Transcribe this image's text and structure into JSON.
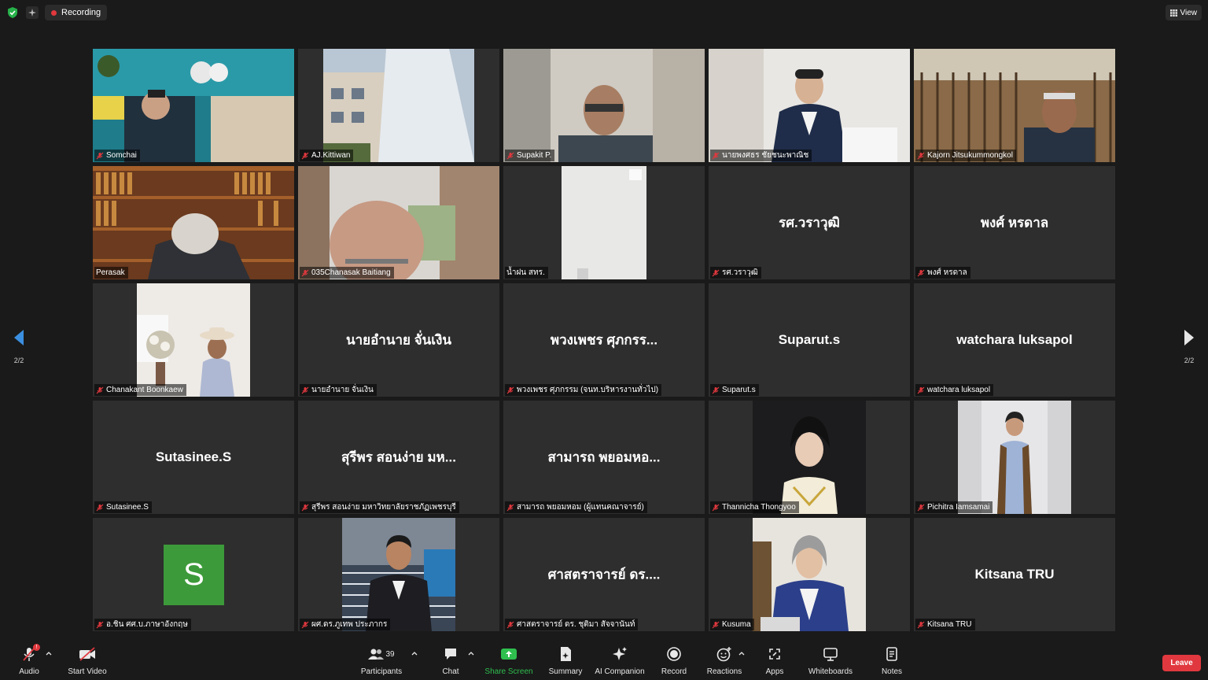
{
  "topbar": {
    "recording_label": "Recording",
    "view_label": "View"
  },
  "nav": {
    "left_page": "2/2",
    "right_page": "2/2"
  },
  "tiles": [
    {
      "name": "Somchai",
      "display": "",
      "has_video": true
    },
    {
      "name": "AJ.Kittiwan",
      "display": "",
      "has_video": true
    },
    {
      "name": "Supakit P.",
      "display": "",
      "has_video": true
    },
    {
      "name": "นายพงศธร ชัยชนะพาณิช",
      "display": "",
      "has_video": true
    },
    {
      "name": "Kajorn Jitsukummongkol",
      "display": "",
      "has_video": true
    },
    {
      "name": "Perasak",
      "display": "",
      "has_video": true
    },
    {
      "name": "035Chanasak  Baitiang",
      "display": "",
      "has_video": true
    },
    {
      "name": "น้ำฝน สทร.",
      "display": "",
      "has_video": true
    },
    {
      "name": "รศ.วราวุฒิ",
      "display": "รศ.วราวุฒิ",
      "has_video": false
    },
    {
      "name": "พงศ์ หรดาล",
      "display": "พงศ์ หรดาล",
      "has_video": false
    },
    {
      "name": "Chanakant Boonkaew",
      "display": "",
      "has_video": true
    },
    {
      "name": "นายอำนาย จั่นเงิน",
      "display": "นายอำนาย จั่นเงิน",
      "has_video": false
    },
    {
      "name": "พวงเพชร ศุภกรรม (จนท.บริหารงานทั่วไป)",
      "display": "พวงเพชร ศุภกรร...",
      "has_video": false
    },
    {
      "name": "Suparut.s",
      "display": "Suparut.s",
      "has_video": false
    },
    {
      "name": "watchara luksapol",
      "display": "watchara luksapol",
      "has_video": false
    },
    {
      "name": "Sutasinee.S",
      "display": "Sutasinee.S",
      "has_video": false
    },
    {
      "name": "สุรีพร สอนง่าย มหาวิทยาลัยราชภัฏเพชรบุรี",
      "display": "สุรีพร สอนง่าย มห...",
      "has_video": false
    },
    {
      "name": "สามารถ พยอมหอม (ผู้แทนคณาจารย์)",
      "display": "สามารถ พยอมหอ...",
      "has_video": false
    },
    {
      "name": "Thannicha Thongyoo",
      "display": "",
      "has_video": true
    },
    {
      "name": "Pichitra Iamsamai",
      "display": "",
      "has_video": true
    },
    {
      "name": "อ.ชิน ศศ.บ.ภาษาอังกฤษ",
      "display": "",
      "avatar_letter": "S",
      "has_video": false
    },
    {
      "name": "ผศ.ดร.ภูเทพ ประภากร",
      "display": "",
      "has_video": true
    },
    {
      "name": "ศาสตราจารย์ ดร. ชุติมา สัจจานันท์",
      "display": "ศาสตราจารย์ ดร....",
      "has_video": false
    },
    {
      "name": "Kusuma",
      "display": "",
      "has_video": true
    },
    {
      "name": "Kitsana TRU",
      "display": "Kitsana TRU",
      "has_video": false
    }
  ],
  "toolbar": {
    "audio": "Audio",
    "start_video": "Start Video",
    "participants": "Participants",
    "participant_count": "39",
    "chat": "Chat",
    "share_screen": "Share Screen",
    "summary": "Summary",
    "ai_companion": "AI Companion",
    "record": "Record",
    "reactions": "Reactions",
    "apps": "Apps",
    "whiteboards": "Whiteboards",
    "notes": "Notes",
    "leave": "Leave",
    "audio_badge": "!"
  },
  "colors": {
    "accent_green": "#2fbf4f",
    "recording_red": "#e0383e",
    "tile_bg": "#2e2e2e",
    "avatar_green": "#3d9a3a"
  }
}
